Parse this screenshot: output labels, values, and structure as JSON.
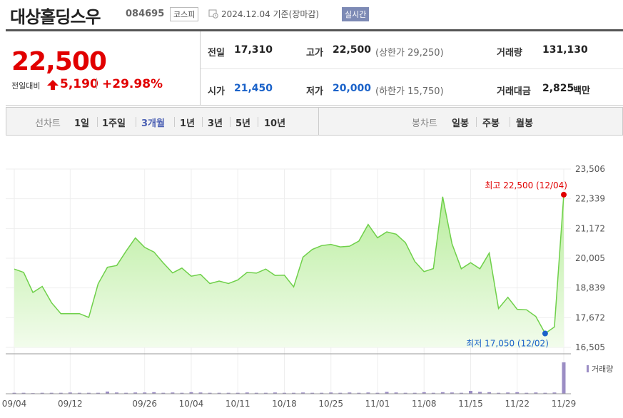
{
  "header": {
    "name": "대상홀딩스우",
    "code": "084695",
    "market": "코스피",
    "date": "2024.12.04 기준(장마감)",
    "live": "실시간"
  },
  "quote": {
    "price": "22,500",
    "change_label": "전일대비",
    "change": "5,190",
    "change_pct": "+29.98%",
    "prev_close_label": "전일",
    "prev_close": "17,310",
    "high_label": "고가",
    "high": "22,500",
    "upper_limit": "(상한가 29,250)",
    "volume_label": "거래량",
    "volume": "131,130",
    "open_label": "시가",
    "open": "21,450",
    "low_label": "저가",
    "low": "20,000",
    "lower_limit": "(하한가 15,750)",
    "amount_label": "거래대금",
    "amount": "2,825",
    "amount_unit": "백만"
  },
  "tabs": {
    "period_label": "선차트",
    "periods": [
      "1일",
      "1주일",
      "3개월",
      "1년",
      "3년",
      "5년",
      "10년"
    ],
    "active_period": "3개월",
    "candle_label": "봉차트",
    "candles": [
      "일봉",
      "주봉",
      "월봉"
    ]
  },
  "colors": {
    "up": "#e10000",
    "down": "#1a62c9",
    "line": "#6fd04a",
    "fill": "#cdf2bd",
    "volume": "#9b8dc4"
  },
  "chart_data": {
    "type": "area",
    "y_ticks": [
      "23,506",
      "22,339",
      "21,172",
      "20,005",
      "18,839",
      "17,672",
      "16,505"
    ],
    "ylim": [
      16505,
      23506
    ],
    "x_ticks": [
      "09/04",
      "09/12",
      "09/26",
      "10/04",
      "10/11",
      "10/18",
      "10/25",
      "11/01",
      "11/08",
      "11/15",
      "11/22",
      "11/29"
    ],
    "x_tick_index": [
      0,
      6,
      14,
      19,
      24,
      29,
      34,
      39,
      44,
      49,
      54,
      59
    ],
    "values": [
      19580,
      19450,
      18660,
      18900,
      18260,
      17830,
      17830,
      17830,
      17680,
      19000,
      19650,
      19720,
      20280,
      20800,
      20430,
      20250,
      19820,
      19430,
      19620,
      19300,
      19370,
      19010,
      19110,
      19010,
      19150,
      19450,
      19420,
      19580,
      19330,
      19340,
      18880,
      20050,
      20350,
      20500,
      20550,
      20450,
      20480,
      20680,
      21330,
      20810,
      21040,
      20950,
      20620,
      19880,
      19480,
      19600,
      22420,
      20570,
      19590,
      19830,
      19590,
      20210,
      18030,
      18470,
      18000,
      17980,
      17720,
      17050,
      17310,
      22500
    ],
    "high_annotation": "최고 22,500 (12/04)",
    "low_annotation": "최저 17,050 (12/02)",
    "high_index": 59,
    "low_index": 57,
    "volume_label": "거래량",
    "volume": [
      3,
      3,
      2,
      3,
      3,
      3,
      4,
      3,
      3,
      3,
      7,
      4,
      3,
      4,
      4,
      5,
      3,
      4,
      3,
      5,
      4,
      3,
      3,
      3,
      3,
      4,
      3,
      3,
      4,
      3,
      3,
      4,
      3,
      3,
      4,
      3,
      4,
      3,
      4,
      3,
      6,
      4,
      3,
      3,
      5,
      3,
      5,
      4,
      3,
      9,
      6,
      5,
      3,
      4,
      5,
      3,
      4,
      3,
      4,
      100
    ]
  }
}
